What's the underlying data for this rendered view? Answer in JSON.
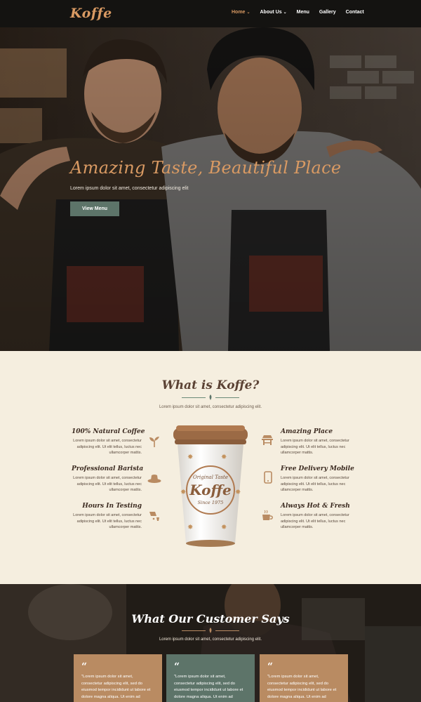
{
  "brand": {
    "logo": "Koffe",
    "accent": "#d99a63",
    "green": "#5d7469"
  },
  "nav": {
    "items": [
      {
        "label": "Home",
        "caret": "⌄",
        "active": true
      },
      {
        "label": "About Us",
        "caret": "⌄",
        "active": false
      },
      {
        "label": "Menu",
        "caret": "",
        "active": false
      },
      {
        "label": "Gallery",
        "caret": "",
        "active": false
      },
      {
        "label": "Contact",
        "caret": "",
        "active": false
      }
    ]
  },
  "hero": {
    "title": "Amazing Taste, Beautiful Place",
    "subtitle": "Lorem ipsum dolor sit amet, consectetur adipiscing elit",
    "button": "View Menu"
  },
  "about": {
    "title": "What is Koffe?",
    "subtitle": "Lorem ipsum dolor sit amet, consectetur adipiscing elit.",
    "cup": {
      "line1": "Original Taste",
      "brand": "Koffe",
      "line2": "Since 1975"
    },
    "features_left": [
      {
        "title": "100% Natural Coffee",
        "text": "Lorem ipsum dolor sit amet, consectetur adipiscing elit. Ut elit tellus, luctus nec ullamcorper mattis.",
        "icon": "sprout-icon"
      },
      {
        "title": "Professional Barista",
        "text": "Lorem ipsum dolor sit amet, consectetur adipiscing elit. Ut elit tellus, luctus nec ullamcorper mattis.",
        "icon": "hat-icon"
      },
      {
        "title": "Hours In Testing",
        "text": "Lorem ipsum dolor sit amet, consectetur adipiscing elit. Ut elit tellus, luctus nec ullamcorper mattis.",
        "icon": "pouring-icon"
      }
    ],
    "features_right": [
      {
        "title": "Amazing Place",
        "text": "Lorem ipsum dolor sit amet, consectetur adipiscing elit. Ut elit tellus, luctus nec ullamcorper mattis.",
        "icon": "table-icon"
      },
      {
        "title": "Free Delivery Mobile",
        "text": "Lorem ipsum dolor sit amet, consectetur adipiscing elit. Ut elit tellus, luctus nec ullamcorper mattis.",
        "icon": "mobile-icon"
      },
      {
        "title": "Always Hot & Fresh",
        "text": "Lorem ipsum dolor sit amet, consectetur adipiscing elit. Ut elit tellus, luctus nec ullamcorper mattis.",
        "icon": "hot-cup-icon"
      }
    ]
  },
  "testimonials": {
    "title": "What Our Customer Says",
    "subtitle": "Lorem ipsum dolor sit amet, consectetur adipiscing elit.",
    "cards": [
      {
        "quote_mark": "“",
        "text": "\"Lorem ipsum dolor sit amet, consectetur adipiscing elit, sed do eiusmod tempor incididunt ut labore et dolore magna aliqua. Ut enim ad",
        "color": "#b98b62"
      },
      {
        "quote_mark": "“",
        "text": "\"Lorem ipsum dolor sit amet, consectetur adipiscing elit, sed do eiusmod tempor incididunt ut labore et dolore magna aliqua. Ut enim ad",
        "color": "#5d7469"
      },
      {
        "quote_mark": "“",
        "text": "\"Lorem ipsum dolor sit amet, consectetur adipiscing elit, sed do eiusmod tempor incididunt ut labore et dolore magna aliqua. Ut enim ad",
        "color": "#b98b62"
      }
    ]
  }
}
